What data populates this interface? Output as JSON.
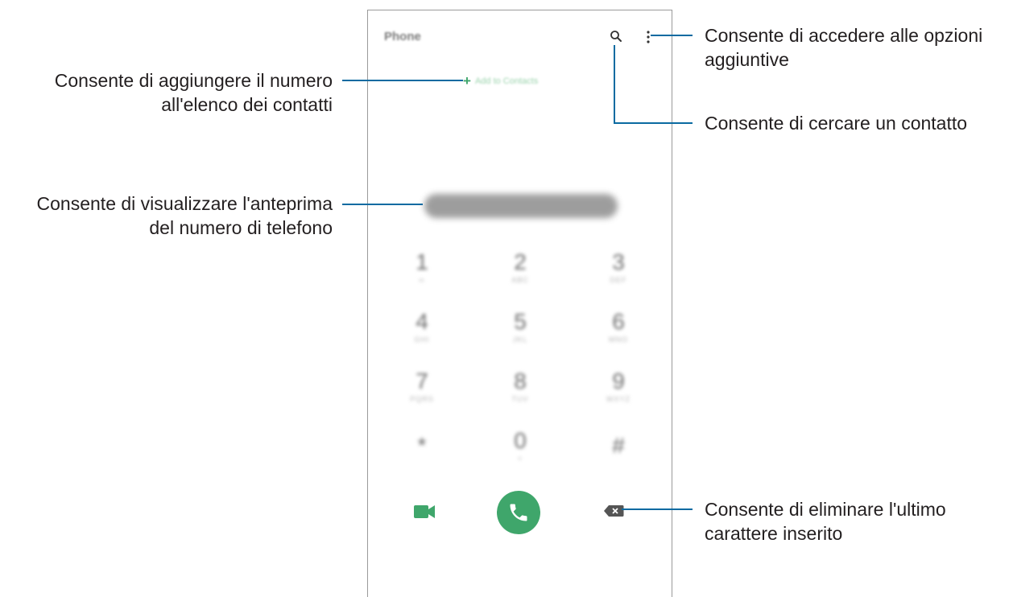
{
  "phone": {
    "title": "Phone",
    "add_to_contacts": "Add to Contacts",
    "keypad": [
      {
        "digit": "1",
        "letters": "∞"
      },
      {
        "digit": "2",
        "letters": "ABC"
      },
      {
        "digit": "3",
        "letters": "DEF"
      },
      {
        "digit": "4",
        "letters": "GHI"
      },
      {
        "digit": "5",
        "letters": "JKL"
      },
      {
        "digit": "6",
        "letters": "MNO"
      },
      {
        "digit": "7",
        "letters": "PQRS"
      },
      {
        "digit": "8",
        "letters": "TUV"
      },
      {
        "digit": "9",
        "letters": "WXYZ"
      },
      {
        "digit": "*",
        "letters": ""
      },
      {
        "digit": "0",
        "letters": "+"
      },
      {
        "digit": "#",
        "letters": ""
      }
    ],
    "icons": {
      "search": "search-icon",
      "more": "more-options-icon",
      "video": "video-call-icon",
      "call": "phone-call-icon",
      "backspace": "backspace-icon"
    },
    "colors": {
      "accent": "#3fa66b",
      "callout_line": "#0a6aa1"
    }
  },
  "callouts": {
    "more_options": [
      "Consente di accedere alle opzioni",
      "aggiuntive"
    ],
    "search": "Consente di cercare un contatto",
    "add_contact": [
      "Consente di aggiungere il numero",
      "all'elenco dei contatti"
    ],
    "preview": [
      "Consente di visualizzare l'anteprima",
      "del numero di telefono"
    ],
    "delete": [
      "Consente di eliminare l'ultimo",
      "carattere inserito"
    ]
  }
}
